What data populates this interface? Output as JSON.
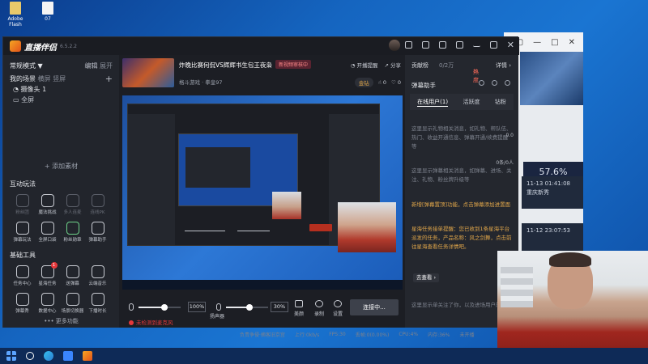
{
  "desktop": {
    "icons": [
      {
        "label": "Adobe Flash",
        "kind": "app"
      },
      {
        "label": "07",
        "kind": "doc"
      }
    ]
  },
  "background_window": {
    "stat_value": "57.6%",
    "stat_label": "胜率",
    "rows": [
      {
        "time": "11-13 01:41:08",
        "text": "重庆新秀"
      },
      {
        "time": "11-12 23:07:53",
        "text": ""
      }
    ]
  },
  "app": {
    "name": "直播伴侣",
    "version": "6.5.2.2",
    "left": {
      "mode_label": "常规模式 ▼",
      "edit_label": "编辑",
      "expand_label": "展开",
      "scenes_tab": "我的场景",
      "scenes_tab2": "横屏",
      "scenes_tab3": "竖屏",
      "scenes_tab4": "可改名",
      "add_scene": "+",
      "scenes": [
        "摄像头 1",
        "全屏"
      ],
      "add_material": "+ 添加素材",
      "interactive_title": "互动玩法",
      "interactive_tools": [
        {
          "label": "粉丝团",
          "enabled": false,
          "icon": "fans-icon"
        },
        {
          "label": "魔法挑战",
          "enabled": true,
          "icon": "magic-icon"
        },
        {
          "label": "多人连麦",
          "enabled": false,
          "icon": "multi-mic-icon"
        },
        {
          "label": "连线PK",
          "enabled": false,
          "icon": "pk-icon"
        },
        {
          "label": "弹幕玩法",
          "enabled": true,
          "icon": "danmaku-icon"
        },
        {
          "label": "全屏口袋",
          "enabled": true,
          "icon": "pocket-icon"
        },
        {
          "label": "粉丝勋章",
          "enabled": true,
          "icon": "medal-icon"
        },
        {
          "label": "弹幕助手",
          "enabled": true,
          "icon": "danmaku-helper-icon"
        }
      ],
      "basic_title": "基础工具",
      "basic_tools": [
        {
          "label": "任务中心",
          "icon": "task-icon",
          "badge": ""
        },
        {
          "label": "星海任务",
          "icon": "ad-icon",
          "badge": "1"
        },
        {
          "label": "送弹幕",
          "icon": "send-danmaku-icon",
          "badge": ""
        },
        {
          "label": "云端音乐",
          "icon": "music-icon",
          "badge": ""
        },
        {
          "label": "弹幕秀",
          "icon": "danmaku-show-icon",
          "badge": ""
        },
        {
          "label": "数据中心",
          "icon": "data-icon",
          "badge": ""
        },
        {
          "label": "场景切换器",
          "icon": "scene-switch-icon",
          "badge": ""
        },
        {
          "label": "下播时长",
          "icon": "timer-icon",
          "badge": ""
        }
      ],
      "more_label": "••• 更多功能"
    },
    "room": {
      "title": "炸晚比赛何侃VS辉辉书生包王夜枭",
      "tag": "新视频审核中",
      "category": "格斗游戏 · 拳皇97",
      "actions": [
        "开播提醒",
        "分享"
      ],
      "chip": "金钻",
      "likes": "0",
      "hearts": "0"
    },
    "mixer": {
      "mic_pct": "100%",
      "speaker_pct": "30%",
      "mic_level": 0.62,
      "speaker_level": 0.55,
      "speaker_label": "扬声器",
      "controls": [
        "美颜",
        "录制",
        "设置"
      ],
      "warning": "未检测到麦克风",
      "go_live": "连接中..."
    },
    "status": {
      "items": [
        "负责争侵·摘客旧京宫",
        "上行:0kb/s",
        "FPS:30",
        "丢帧:0(0.00%)",
        "CPU:4%",
        "内存:36%",
        "未开播"
      ]
    },
    "right": {
      "rank_label": "贡献榜",
      "rank_value": "0/2万",
      "hot_label": "热度",
      "detail_label": "详情 ›",
      "helper_title": "弹幕助手",
      "tabs": [
        "在线用户(1)",
        "活跃度",
        "钻粉"
      ],
      "notice1": "这里显示礼物相关消息，如礼物、帮队伍、热门、收益开通信息、弹幕开通/续费提醒等",
      "count1": "0.0",
      "notice2": "这里显示弹幕相关消息，如弹幕、进场、关注、礼物、粉丝牌升级等",
      "count2": "0条/0人",
      "notice3": "新增[弹幕置顶]功能，点击弹幕添加进置面",
      "notice4": "星海任务接单提醒：您已收到1条星海平台派发的任务，产品名称：风之剑舞，点击前往星海查看任务详情吧。",
      "go_look": "去查看 ›",
      "notice5": "这里显示单关注了你，以及进场用户的消息"
    }
  },
  "taskbar": {
    "items": [
      "start-icon",
      "search-icon",
      "edge-icon",
      "store-icon",
      "live-app-icon"
    ]
  }
}
